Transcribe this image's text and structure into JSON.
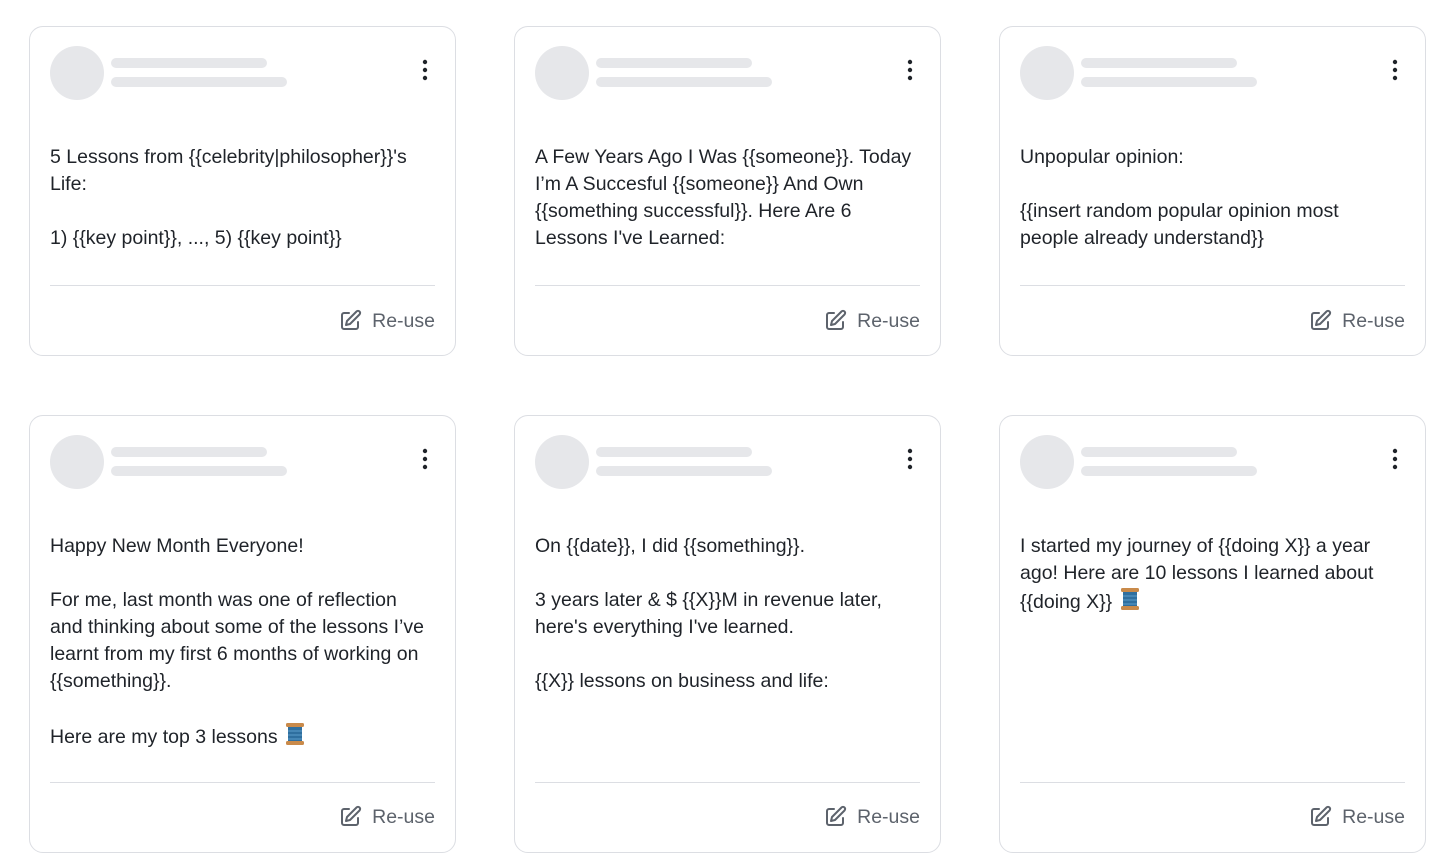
{
  "cards": [
    {
      "text": "5 Lessons from {{celebrity|philosopher}}'s\nLife:\n\n1) {{key point}}, ..., 5) {{key point}}",
      "reuse_label": "Re-use",
      "emoji": ""
    },
    {
      "text": "A Few Years Ago I Was {{someone}}. Today\nI’m A Succesful {{someone}} And Own\n{{something successful}}. Here Are 6\nLessons I've Learned:",
      "reuse_label": "Re-use",
      "emoji": ""
    },
    {
      "text": "Unpopular opinion:\n\n{{insert random popular opinion most\npeople already understand}}",
      "reuse_label": "Re-use",
      "emoji": ""
    },
    {
      "text": "Happy New Month Everyone!\n\nFor me, last month was one of reflection\nand thinking about some of the lessons I’ve\nlearnt from my first 6 months of working on\n{{something}}.\n\nHere are my top 3 lessons ",
      "reuse_label": "Re-use",
      "emoji": "spool-of-thread"
    },
    {
      "text": "On {{date}}, I did {{something}}.\n\n3 years later & $ {{X}}M in revenue later,\nhere's everything I've learned.\n\n{{X}} lessons on business and life:",
      "reuse_label": "Re-use",
      "emoji": ""
    },
    {
      "text": "I started my journey of {{doing X}} a year\nago! Here are 10 lessons I learned about\n{{doing X}} ",
      "reuse_label": "Re-use",
      "emoji": "spool-of-thread"
    }
  ],
  "colors": {
    "card_border": "#dcdee3",
    "placeholder": "#e6e7ea",
    "text": "#1f2329",
    "muted": "#5d636c",
    "spool_thread": "#2f6f9f",
    "spool_wood": "#c98a4a"
  }
}
